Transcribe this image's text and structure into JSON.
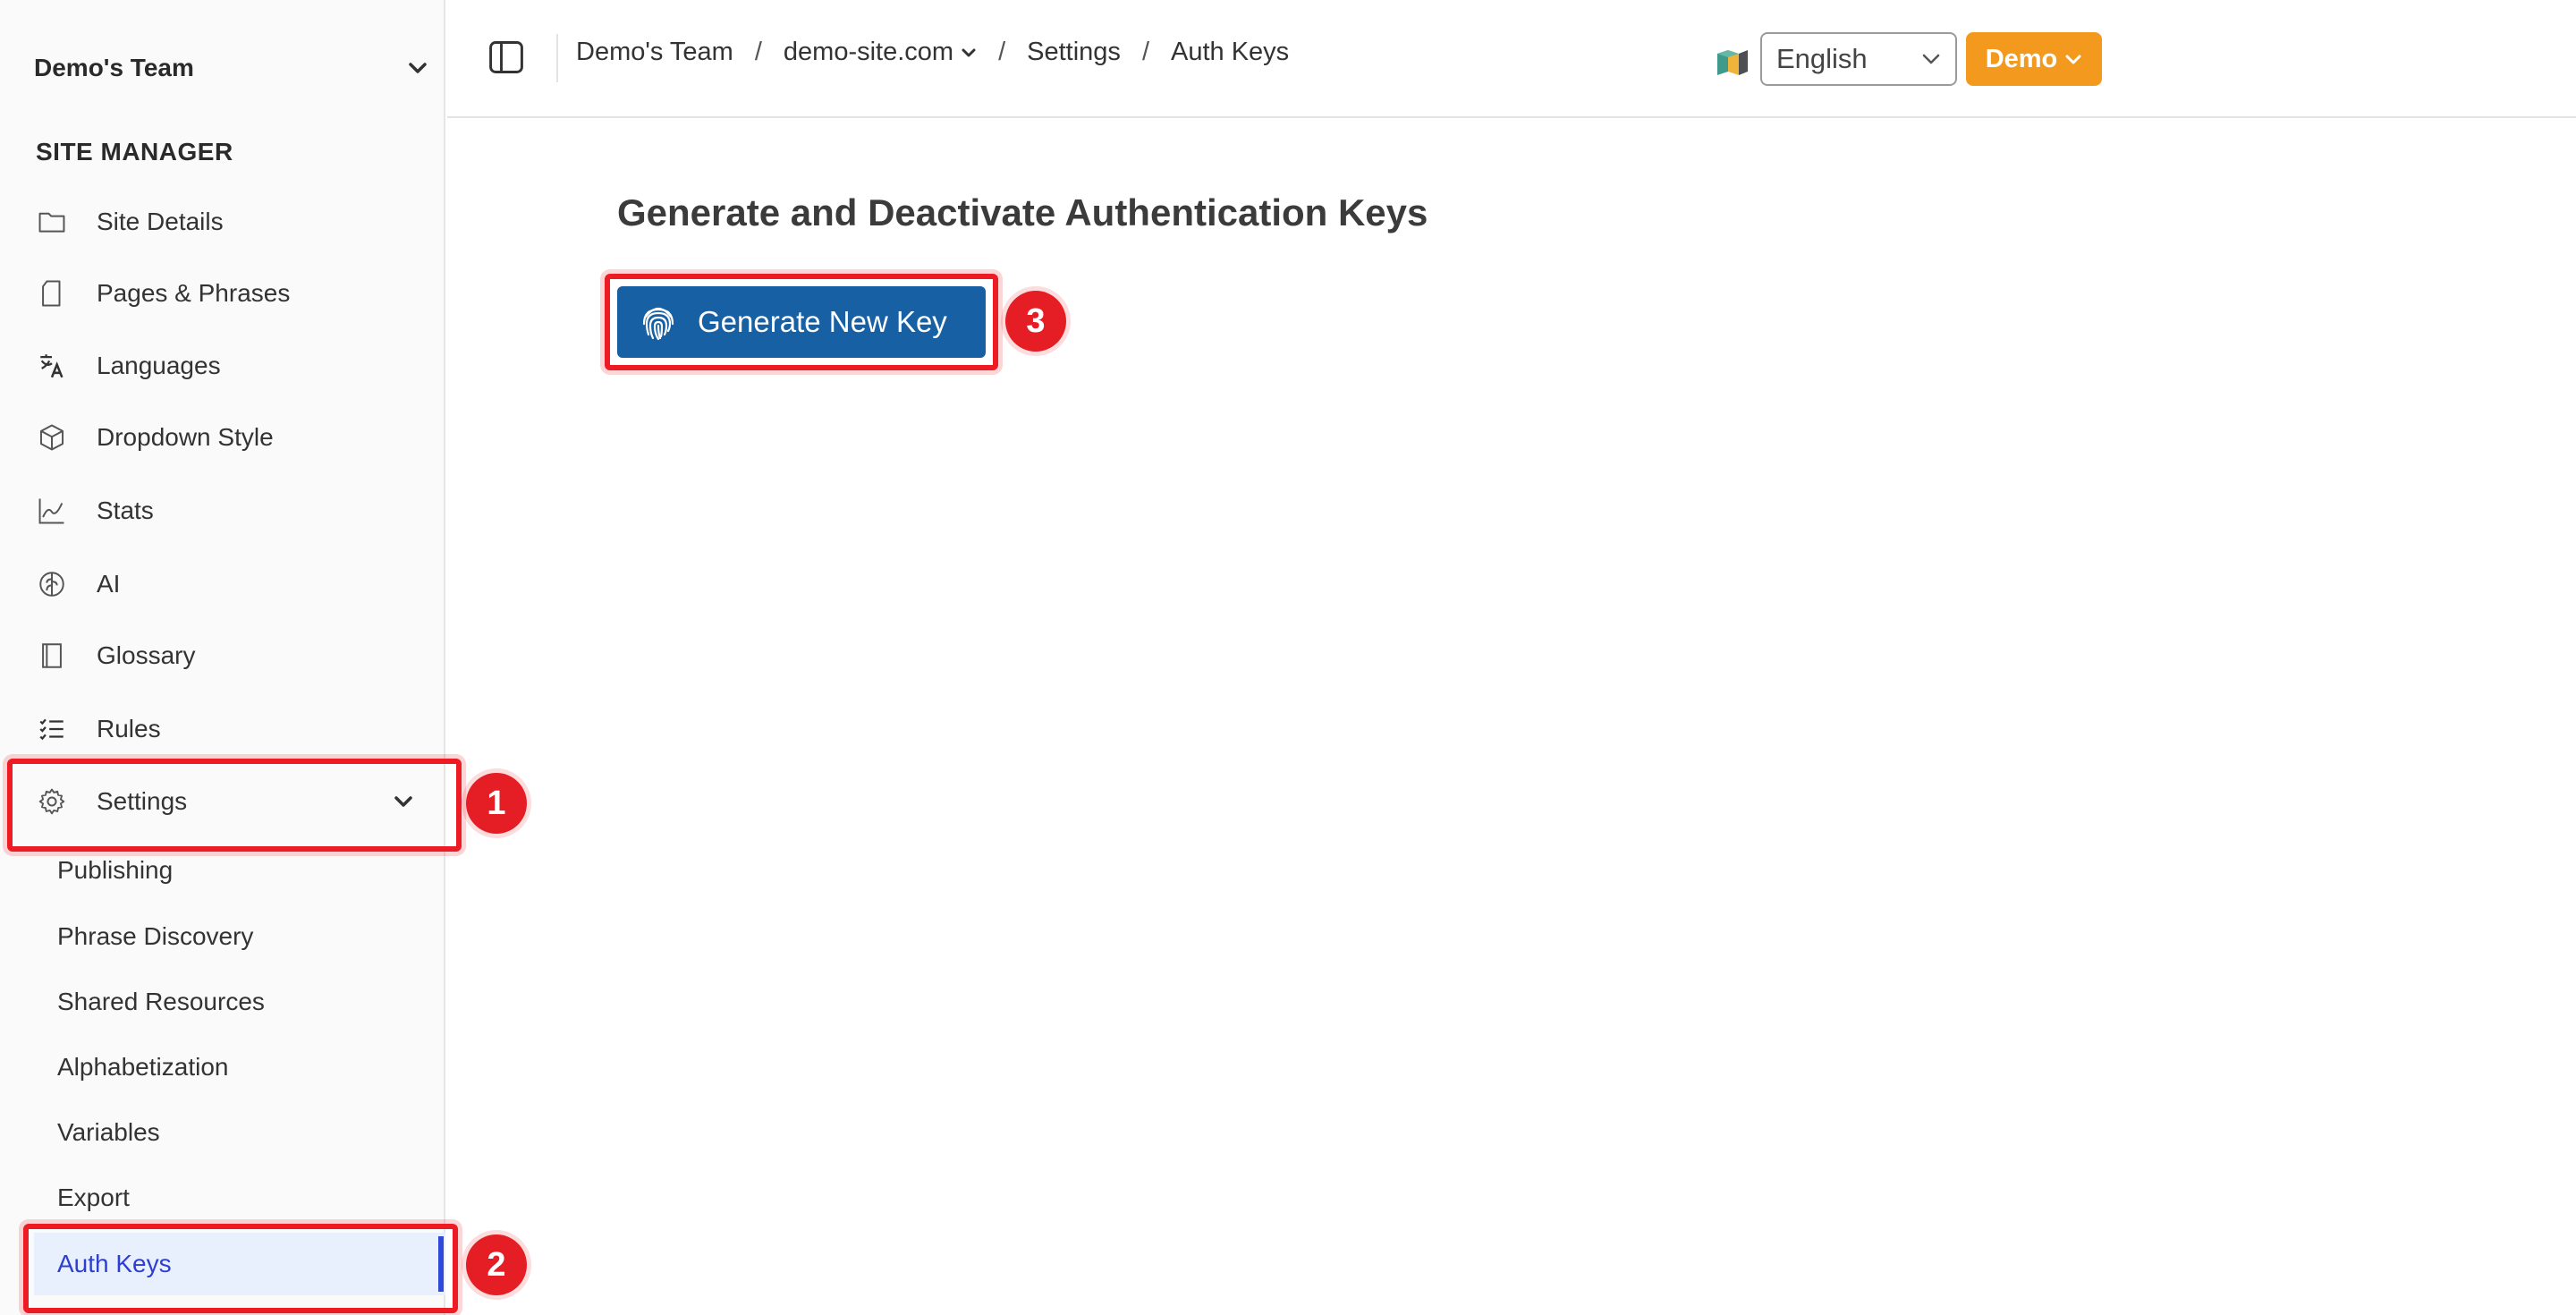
{
  "sidebar": {
    "team_name": "Demo's Team",
    "section_title": "SITE MANAGER",
    "items": [
      {
        "label": "Site Details",
        "icon": "folder-icon"
      },
      {
        "label": "Pages & Phrases",
        "icon": "file-icon"
      },
      {
        "label": "Languages",
        "icon": "translate-icon"
      },
      {
        "label": "Dropdown Style",
        "icon": "cube-icon"
      },
      {
        "label": "Stats",
        "icon": "chart-line-icon"
      },
      {
        "label": "AI",
        "icon": "brain-icon"
      },
      {
        "label": "Glossary",
        "icon": "book-icon"
      },
      {
        "label": "Rules",
        "icon": "list-check-icon"
      }
    ],
    "settings": {
      "label": "Settings",
      "icon": "gear-icon",
      "sub_items": [
        "Publishing",
        "Phrase Discovery",
        "Shared Resources",
        "Alphabetization",
        "Variables",
        "Export"
      ],
      "active_item": "Auth Keys"
    }
  },
  "topbar": {
    "breadcrumb": [
      "Demo's Team",
      "demo-site.com",
      "Settings",
      "Auth Keys"
    ],
    "separator": "/",
    "language": "English",
    "account_button": "Demo"
  },
  "main": {
    "title": "Generate and Deactivate Authentication Keys",
    "generate_button": "Generate New Key"
  },
  "callouts": [
    "1",
    "2",
    "3"
  ],
  "colors": {
    "accent_blue": "#1760a4",
    "orange": "#f39a1e",
    "highlight_red": "#ec1b24",
    "active_text": "#2d3ed0"
  }
}
